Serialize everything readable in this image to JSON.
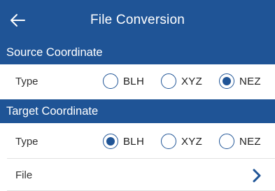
{
  "header": {
    "title": "File Conversion",
    "back_icon": "arrow-left-icon"
  },
  "source": {
    "section_title": "Source Coordinate",
    "type_label": "Type",
    "options": [
      {
        "label": "BLH",
        "selected": false
      },
      {
        "label": "XYZ",
        "selected": false
      },
      {
        "label": "NEZ",
        "selected": true
      }
    ]
  },
  "target": {
    "section_title": "Target Coordinate",
    "type_label": "Type",
    "options": [
      {
        "label": "BLH",
        "selected": true
      },
      {
        "label": "XYZ",
        "selected": false
      },
      {
        "label": "NEZ",
        "selected": false
      }
    ]
  },
  "file": {
    "label": "File",
    "chevron_icon": "chevron-right-icon"
  },
  "colors": {
    "primary": "#1f5496",
    "background": "#ffffff"
  }
}
